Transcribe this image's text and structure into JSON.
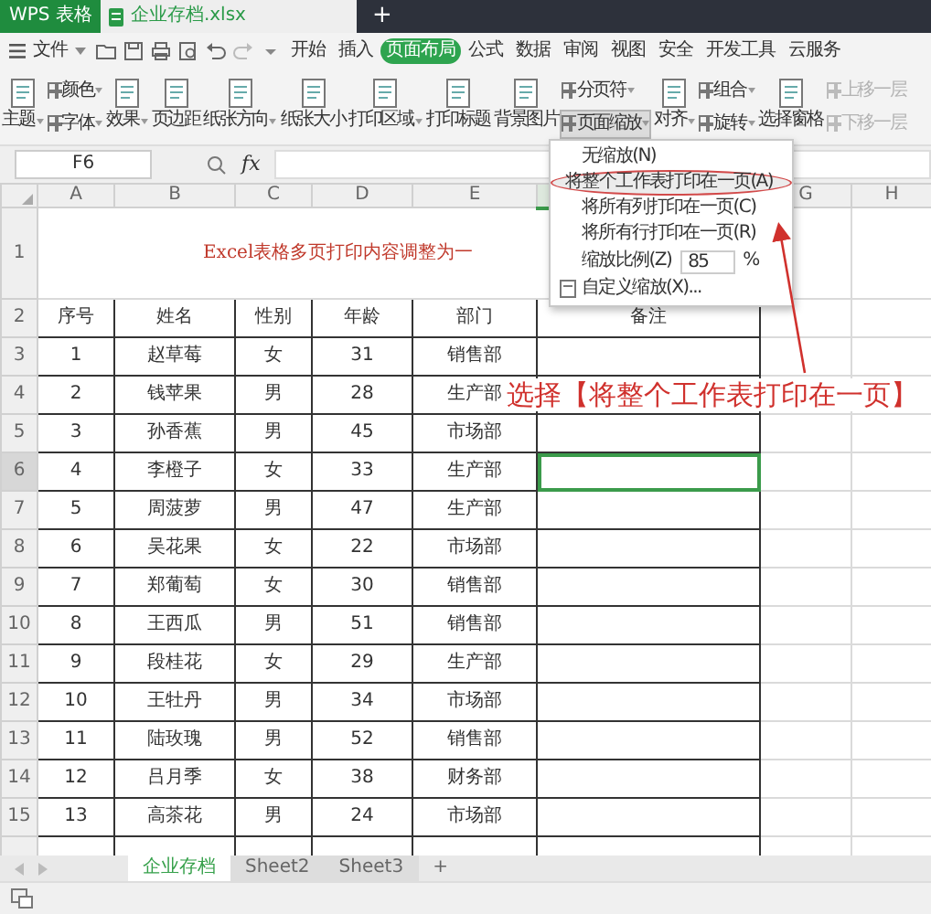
{
  "title_bar": {
    "app": "WPS 表格",
    "document": "企业存档.xlsx",
    "new_tab": "+"
  },
  "menu": {
    "file": "文件",
    "tabs": [
      {
        "label": "开始",
        "selected": false
      },
      {
        "label": "插入",
        "selected": false
      },
      {
        "label": "页面布局",
        "selected": true
      },
      {
        "label": "公式",
        "selected": false
      },
      {
        "label": "数据",
        "selected": false
      },
      {
        "label": "审阅",
        "selected": false
      },
      {
        "label": "视图",
        "selected": false
      },
      {
        "label": "安全",
        "selected": false
      },
      {
        "label": "开发工具",
        "selected": false
      },
      {
        "label": "云服务",
        "selected": false
      }
    ]
  },
  "ribbon": [
    {
      "kind": "large",
      "items": [
        {
          "label": "主题",
          "dropdown": true,
          "pressed": false,
          "disabled": false
        }
      ]
    },
    {
      "kind": "stack",
      "items": [
        {
          "label": "颜色",
          "dropdown": true,
          "pressed": false,
          "disabled": false
        },
        {
          "label": "字体",
          "dropdown": true,
          "pressed": false,
          "disabled": false
        }
      ]
    },
    {
      "kind": "large",
      "items": [
        {
          "label": "效果",
          "dropdown": true,
          "pressed": false,
          "disabled": false
        }
      ]
    },
    {
      "kind": "large",
      "items": [
        {
          "label": "页边距",
          "dropdown": false,
          "pressed": false,
          "disabled": false
        }
      ]
    },
    {
      "kind": "large",
      "items": [
        {
          "label": "纸张方向",
          "dropdown": true,
          "pressed": false,
          "disabled": false
        }
      ]
    },
    {
      "kind": "large",
      "items": [
        {
          "label": "纸张大小",
          "dropdown": false,
          "pressed": false,
          "disabled": false
        }
      ]
    },
    {
      "kind": "large",
      "items": [
        {
          "label": "打印区域",
          "dropdown": true,
          "pressed": false,
          "disabled": false
        }
      ]
    },
    {
      "kind": "large",
      "items": [
        {
          "label": "打印标题",
          "dropdown": false,
          "pressed": false,
          "disabled": false
        }
      ]
    },
    {
      "kind": "large",
      "items": [
        {
          "label": "背景图片",
          "dropdown": false,
          "pressed": false,
          "disabled": false
        }
      ]
    },
    {
      "kind": "stack",
      "items": [
        {
          "label": "分页符",
          "dropdown": true,
          "pressed": false,
          "disabled": false
        },
        {
          "label": "页面缩放",
          "dropdown": true,
          "pressed": true,
          "disabled": false
        }
      ]
    },
    {
      "kind": "large",
      "items": [
        {
          "label": "对齐",
          "dropdown": true,
          "pressed": false,
          "disabled": false
        }
      ]
    },
    {
      "kind": "stack",
      "items": [
        {
          "label": "组合",
          "dropdown": true,
          "pressed": false,
          "disabled": false
        },
        {
          "label": "旋转",
          "dropdown": true,
          "pressed": false,
          "disabled": false
        }
      ]
    },
    {
      "kind": "large",
      "items": [
        {
          "label": "选择窗格",
          "dropdown": false,
          "pressed": false,
          "disabled": false
        }
      ]
    },
    {
      "kind": "stack",
      "items": [
        {
          "label": "上移一层",
          "dropdown": false,
          "pressed": false,
          "disabled": true
        },
        {
          "label": "下移一层",
          "dropdown": false,
          "pressed": false,
          "disabled": true
        }
      ]
    }
  ],
  "formula_bar": {
    "cell_ref": "F6",
    "fx": "fx"
  },
  "sheet": {
    "columns": [
      {
        "label": "A",
        "selected": false
      },
      {
        "label": "B",
        "selected": false
      },
      {
        "label": "C",
        "selected": false
      },
      {
        "label": "D",
        "selected": false
      },
      {
        "label": "E",
        "selected": false
      },
      {
        "selected": true
      },
      {
        "label": "G",
        "selected": false
      },
      {
        "label": "H",
        "selected": false
      }
    ],
    "title_row": {
      "number": "1",
      "text": "Excel表格多页打印内容调整为一"
    },
    "header_row": {
      "number": "2",
      "cells": [
        "序号",
        "姓名",
        "性别",
        "年龄",
        "部门",
        "备注"
      ]
    },
    "rows": [
      {
        "number": "3",
        "selected": false,
        "cells": [
          "1",
          "赵草莓",
          "女",
          "31",
          "销售部"
        ]
      },
      {
        "number": "4",
        "selected": false,
        "cells": [
          "2",
          "钱苹果",
          "男",
          "28",
          "生产部"
        ]
      },
      {
        "number": "5",
        "selected": false,
        "cells": [
          "3",
          "孙香蕉",
          "男",
          "45",
          "市场部"
        ]
      },
      {
        "number": "6",
        "selected": true,
        "cells": [
          "4",
          "李橙子",
          "女",
          "33",
          "生产部"
        ]
      },
      {
        "number": "7",
        "selected": false,
        "cells": [
          "5",
          "周菠萝",
          "男",
          "47",
          "生产部"
        ]
      },
      {
        "number": "8",
        "selected": false,
        "cells": [
          "6",
          "吴花果",
          "女",
          "22",
          "市场部"
        ]
      },
      {
        "number": "9",
        "selected": false,
        "cells": [
          "7",
          "郑葡萄",
          "女",
          "30",
          "销售部"
        ]
      },
      {
        "number": "10",
        "selected": false,
        "cells": [
          "8",
          "王西瓜",
          "男",
          "51",
          "销售部"
        ]
      },
      {
        "number": "11",
        "selected": false,
        "cells": [
          "9",
          "段桂花",
          "女",
          "29",
          "生产部"
        ]
      },
      {
        "number": "12",
        "selected": false,
        "cells": [
          "10",
          "王牡丹",
          "男",
          "34",
          "市场部"
        ]
      },
      {
        "number": "13",
        "selected": false,
        "cells": [
          "11",
          "陆玫瑰",
          "男",
          "52",
          "销售部"
        ]
      },
      {
        "number": "14",
        "selected": false,
        "cells": [
          "12",
          "吕月季",
          "女",
          "38",
          "财务部"
        ]
      },
      {
        "number": "15",
        "selected": false,
        "cells": [
          "13",
          "高茶花",
          "男",
          "24",
          "市场部"
        ]
      }
    ]
  },
  "zoom_menu": {
    "items": [
      {
        "kind": "option",
        "label": "无缩放(N)",
        "selected": false
      },
      {
        "kind": "option",
        "label": "将整个工作表打印在一页(A)",
        "selected": true
      },
      {
        "kind": "option",
        "label": "将所有列打印在一页(C)",
        "selected": false
      },
      {
        "kind": "option",
        "label": "将所有行打印在一页(R)",
        "selected": false
      },
      {
        "kind": "scale",
        "label": "缩放比例(Z)",
        "value": "85",
        "unit": "%",
        "selected": false
      },
      {
        "kind": "custom",
        "label": "自定义缩放(X)...",
        "selected": false
      }
    ]
  },
  "annotation": {
    "text": "选择【将整个工作表打印在一页】"
  },
  "sheet_tabs": [
    {
      "label": "企业存档",
      "selected": true
    },
    {
      "label": "Sheet2",
      "selected": false
    },
    {
      "label": "Sheet3",
      "selected": false
    }
  ],
  "add_sheet": "+"
}
